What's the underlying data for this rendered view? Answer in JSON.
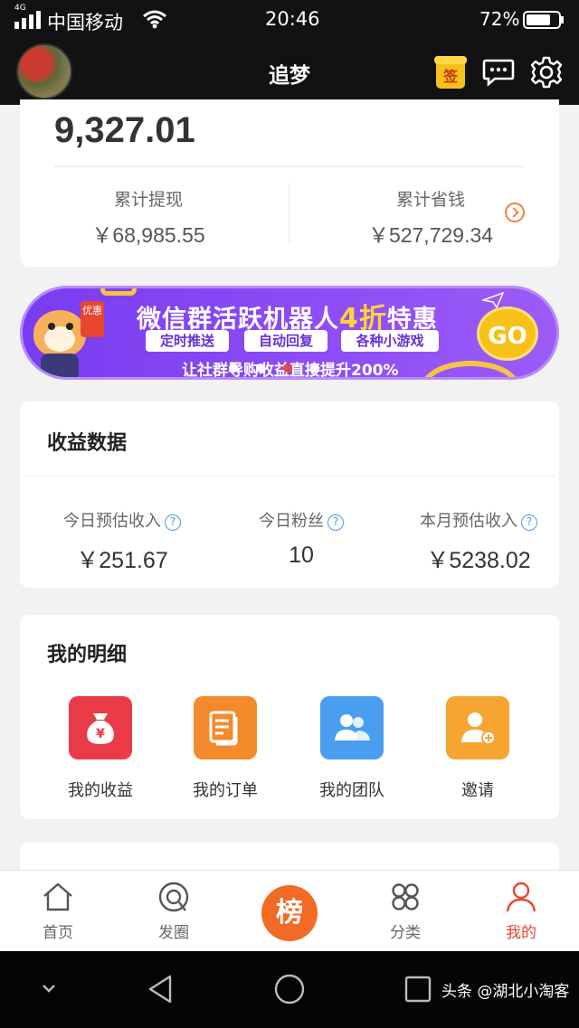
{
  "status_bar": {
    "network": "4G",
    "carrier": "中国移动",
    "time": "20:46",
    "battery": "72%"
  },
  "header": {
    "title": "追梦",
    "sign_label": "签"
  },
  "summary": {
    "balance": "9,327.01",
    "withdrawn_label": "累计提现",
    "withdrawn_value": "￥68,985.55",
    "saved_label": "累计省钱",
    "saved_value": "￥527,729.34"
  },
  "banner": {
    "headline_prefix": "微信群活跃机器人",
    "headline_highlight": "4折",
    "headline_suffix": "特惠",
    "chips": [
      "定时推送",
      "自动回复",
      "各种小游戏"
    ],
    "subline": "让社群导购收益直接提升200%",
    "go_label": "GO",
    "badge": "优惠",
    "page_count": 5,
    "active_page": 3
  },
  "earnings": {
    "title": "收益数据",
    "metrics": [
      {
        "label": "今日预估收入",
        "value": "￥251.67"
      },
      {
        "label": "今日粉丝",
        "value": "10"
      },
      {
        "label": "本月预估收入",
        "value": "￥5238.02"
      }
    ],
    "help_glyph": "?"
  },
  "details": {
    "title": "我的明细",
    "items": [
      {
        "label": "我的收益",
        "icon": "money-bag-icon",
        "color": "#ec3b48"
      },
      {
        "label": "我的订单",
        "icon": "order-doc-icon",
        "color": "#f58a2c"
      },
      {
        "label": "我的团队",
        "icon": "team-icon",
        "color": "#4a9ef0"
      },
      {
        "label": "邀请",
        "icon": "invite-user-icon",
        "color": "#f6a532"
      }
    ]
  },
  "tabbar": {
    "tabs": [
      {
        "label": "首页",
        "icon": "home-icon"
      },
      {
        "label": "发圈",
        "icon": "moments-icon"
      },
      {
        "label": "榜",
        "icon": "ranking-button"
      },
      {
        "label": "分类",
        "icon": "category-icon"
      },
      {
        "label": "我的",
        "icon": "profile-icon"
      }
    ],
    "active": "我的"
  },
  "watermark": "头条 @湖北小淘客",
  "colors": {
    "accent": "#e8462f",
    "orange": "#f26a25",
    "banner_purple": "#7a3cf0",
    "help_blue": "#4a9be8"
  }
}
